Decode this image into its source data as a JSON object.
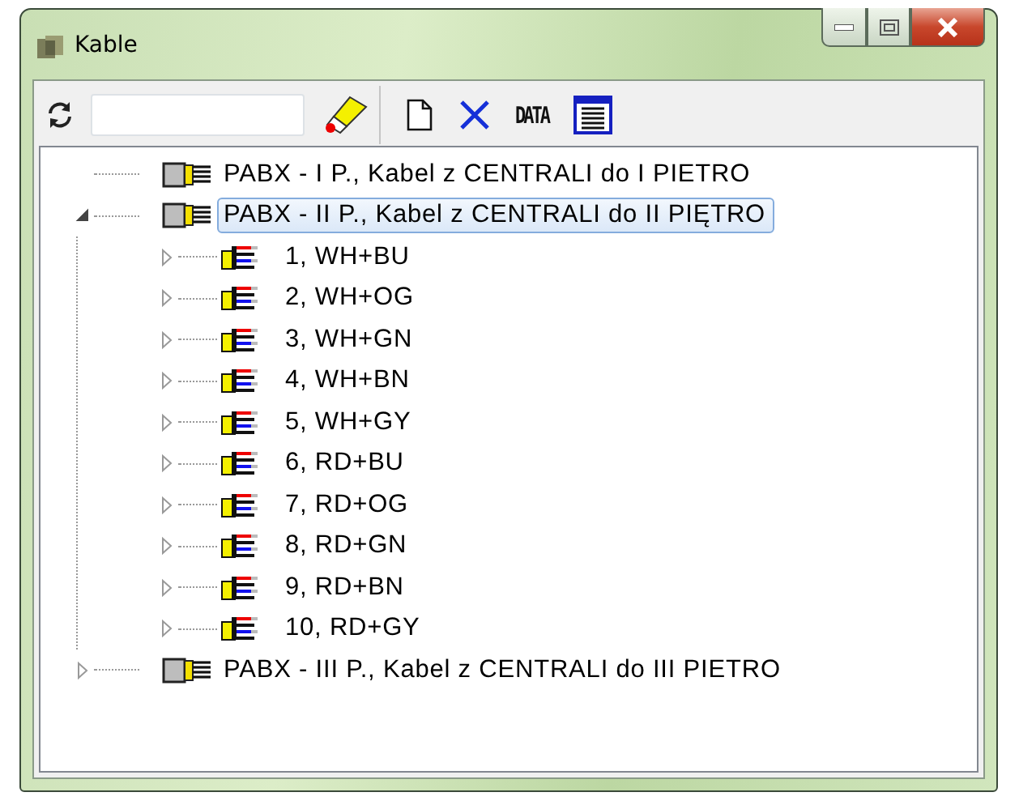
{
  "window": {
    "title": "Kable"
  },
  "toolbar": {
    "data_button": "DATA"
  },
  "tree": [
    {
      "label": "PABX - I P., Kabel z CENTRALI do I PIETRO",
      "kind": "cable",
      "expandable": false,
      "selected": false
    },
    {
      "label": "PABX - II P., Kabel z CENTRALI do II PIĘTRO",
      "kind": "cable",
      "expandable": true,
      "expanded": true,
      "selected": true,
      "children": [
        {
          "label": "1, WH+BU",
          "kind": "pair",
          "expandable": true,
          "expanded": false,
          "selected": false
        },
        {
          "label": "2, WH+OG",
          "kind": "pair",
          "expandable": true,
          "expanded": false,
          "selected": false
        },
        {
          "label": "3, WH+GN",
          "kind": "pair",
          "expandable": true,
          "expanded": false,
          "selected": false
        },
        {
          "label": "4, WH+BN",
          "kind": "pair",
          "expandable": true,
          "expanded": false,
          "selected": false
        },
        {
          "label": "5, WH+GY",
          "kind": "pair",
          "expandable": true,
          "expanded": false,
          "selected": false
        },
        {
          "label": "6, RD+BU",
          "kind": "pair",
          "expandable": true,
          "expanded": false,
          "selected": false
        },
        {
          "label": "7, RD+OG",
          "kind": "pair",
          "expandable": true,
          "expanded": false,
          "selected": false
        },
        {
          "label": "8, RD+GN",
          "kind": "pair",
          "expandable": true,
          "expanded": false,
          "selected": false
        },
        {
          "label": "9, RD+BN",
          "kind": "pair",
          "expandable": true,
          "expanded": false,
          "selected": false
        },
        {
          "label": "10, RD+GY",
          "kind": "pair",
          "expandable": true,
          "expanded": false,
          "selected": false
        }
      ]
    },
    {
      "label": "PABX - III P., Kabel z CENTRALI do III PIETRO",
      "kind": "cable",
      "expandable": true,
      "expanded": false,
      "selected": false
    }
  ]
}
